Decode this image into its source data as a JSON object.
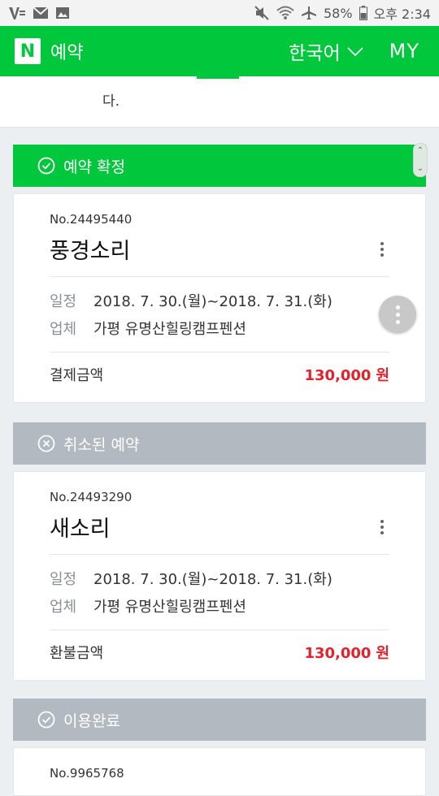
{
  "status_bar": {
    "left_icons": [
      "vibration-icon",
      "mail-icon",
      "image-icon"
    ],
    "battery_text": "58%",
    "time": "오후 2:34",
    "right_icons": [
      "mute-icon",
      "wifi-icon",
      "airplane-icon",
      "battery-icon"
    ]
  },
  "header": {
    "logo": "N",
    "title": "예약",
    "language": "한국어",
    "my": "MY"
  },
  "notice": {
    "text": "다."
  },
  "colors": {
    "accent": "#00c73c",
    "price": "#e2222d",
    "canceled": "#b3b9c1"
  },
  "sections": [
    {
      "status": "예약 확정",
      "reservation_no": "No.24495440",
      "name": "풍경소리",
      "schedule_label": "일정",
      "schedule": "2018. 7. 30.(월)~2018. 7. 31.(화)",
      "vendor_label": "업체",
      "vendor": "가평 유명산힐링캠프펜션",
      "amount_label": "결제금액",
      "amount": "130,000",
      "currency": "원"
    },
    {
      "status": "취소된 예약",
      "reservation_no": "No.24493290",
      "name": "새소리",
      "schedule_label": "일정",
      "schedule": "2018. 7. 30.(월)~2018. 7. 31.(화)",
      "vendor_label": "업체",
      "vendor": "가평 유명산힐링캠프펜션",
      "amount_label": "환불금액",
      "amount": "130,000",
      "currency": "원"
    },
    {
      "status": "이용완료",
      "reservation_no": "No.9965768"
    }
  ]
}
